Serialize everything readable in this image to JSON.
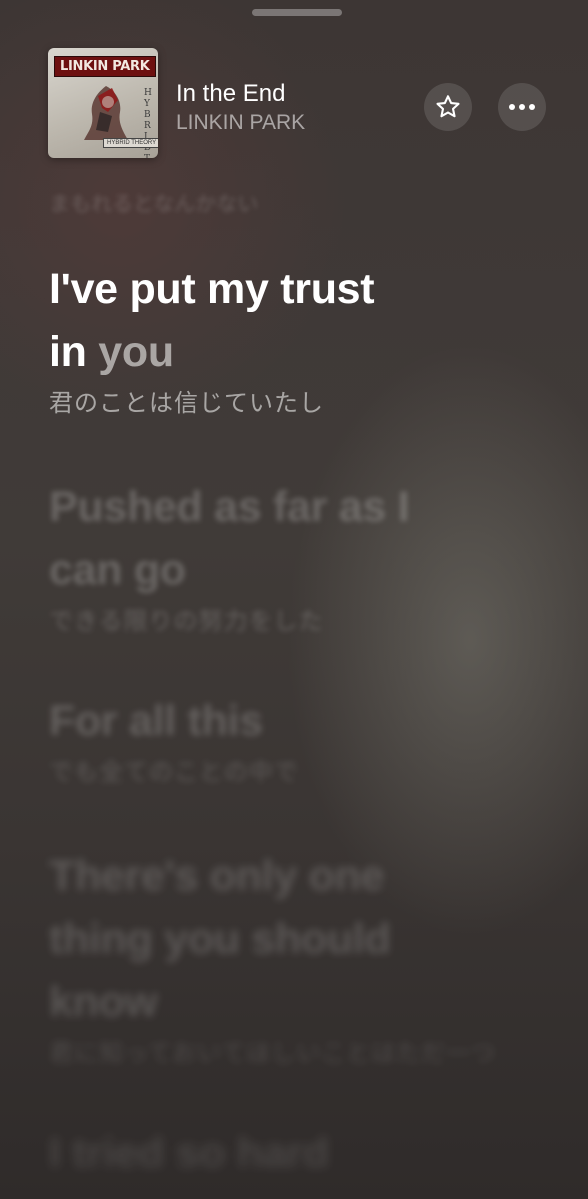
{
  "now_playing": {
    "title": "In the End",
    "artist": "LINKIN PARK",
    "album_art": {
      "logo_text": "LINKIN PARK",
      "subtitle": "HYBRID THEORY",
      "side_text": "HYBRID THEORY"
    }
  },
  "controls": {
    "favorite_icon": "star-outline-icon",
    "more_icon": "ellipsis-icon"
  },
  "lyrics": {
    "previous_translation": "まもれるとなんかない",
    "active": {
      "line_part1": "I've put my trust",
      "line_part2_sung": "in",
      "line_part2_unsung": " you",
      "translation": "君のことは信じていたし"
    },
    "upcoming": [
      {
        "line_1": "Pushed as far as I",
        "line_2": "can go",
        "translation": "できる限りの努力をした"
      },
      {
        "line_1": "For all this",
        "translation": "でも全てのことの中で"
      },
      {
        "line_1": "There's only one",
        "line_2": "thing you should",
        "line_3": "know",
        "translation": "君に知っておいてほしいことはただ一つ"
      },
      {
        "line_1": "I tried so hard"
      }
    ]
  }
}
